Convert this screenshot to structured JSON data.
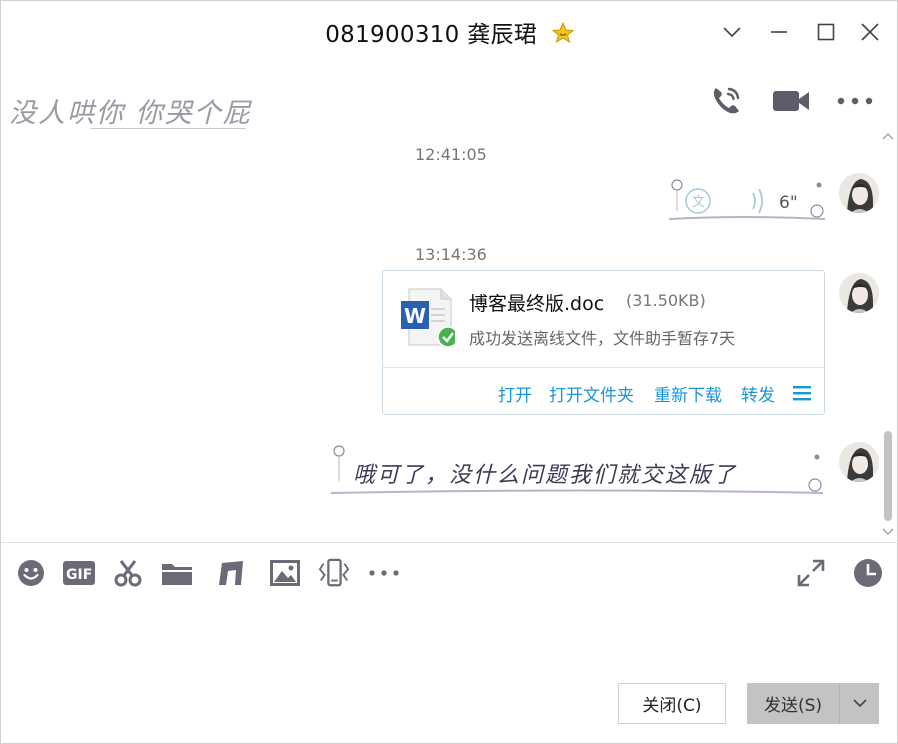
{
  "window": {
    "title": "081900310 龚辰珺"
  },
  "profile": {
    "signature": "没人哄你 你哭个屁"
  },
  "messages": [
    {
      "type": "time",
      "text": "12:41:05"
    },
    {
      "type": "voice",
      "duration": "6\""
    },
    {
      "type": "time",
      "text": "13:14:36"
    },
    {
      "type": "file",
      "file_name": "博客最终版.doc",
      "file_size": "(31.50KB)",
      "status": "成功发送离线文件，文件助手暂存7天",
      "actions": [
        "打开",
        "打开文件夹",
        "重新下载",
        "转发"
      ]
    },
    {
      "type": "text",
      "text": "哦可了，没什么问题我们就交这版了"
    }
  ],
  "footer": {
    "close_label": "关闭(C)",
    "send_label": "发送(S)"
  },
  "colors": {
    "link": "#1a96d6",
    "icon": "#6b6b78",
    "send_bg": "#c3c3c3",
    "success": "#4caf50",
    "word_blue": "#2b5fb4"
  }
}
